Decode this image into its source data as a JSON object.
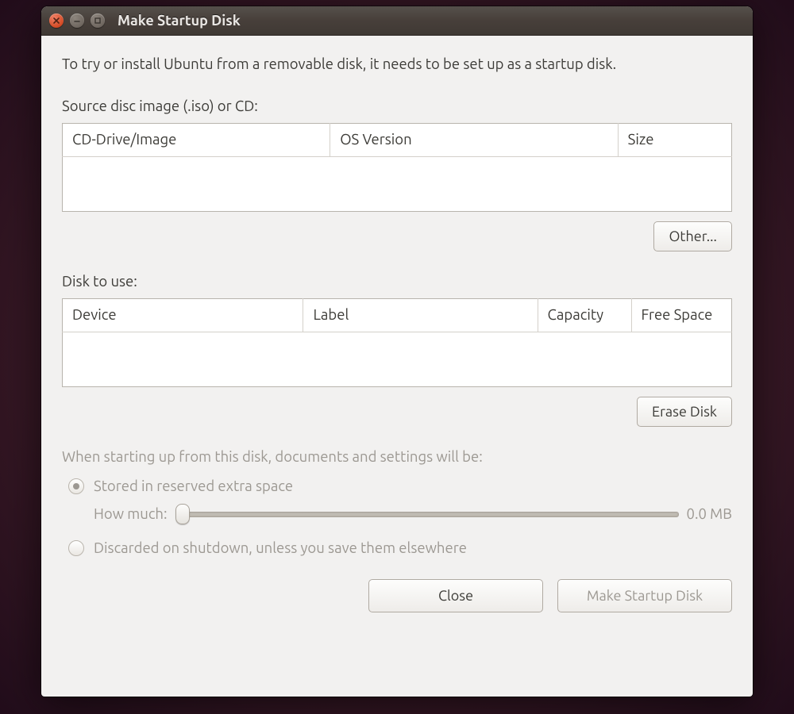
{
  "window": {
    "title": "Make Startup Disk"
  },
  "intro": "To try or install Ubuntu from a removable disk, it needs to be set up as a startup disk.",
  "source": {
    "label": "Source disc image (.iso) or CD:",
    "columns": [
      "CD-Drive/Image",
      "OS Version",
      "Size"
    ],
    "rows": [],
    "other_button": "Other..."
  },
  "disk": {
    "label": "Disk to use:",
    "columns": [
      "Device",
      "Label",
      "Capacity",
      "Free Space"
    ],
    "rows": [],
    "erase_button": "Erase Disk"
  },
  "persistence": {
    "title": "When starting up from this disk, documents and settings will be:",
    "option_stored": "Stored in reserved extra space",
    "how_much_label": "How much:",
    "slider_value": "0.0 MB",
    "option_discarded": "Discarded on shutdown, unless you save them elsewhere",
    "selected": "stored"
  },
  "footer": {
    "close": "Close",
    "make": "Make Startup Disk"
  }
}
